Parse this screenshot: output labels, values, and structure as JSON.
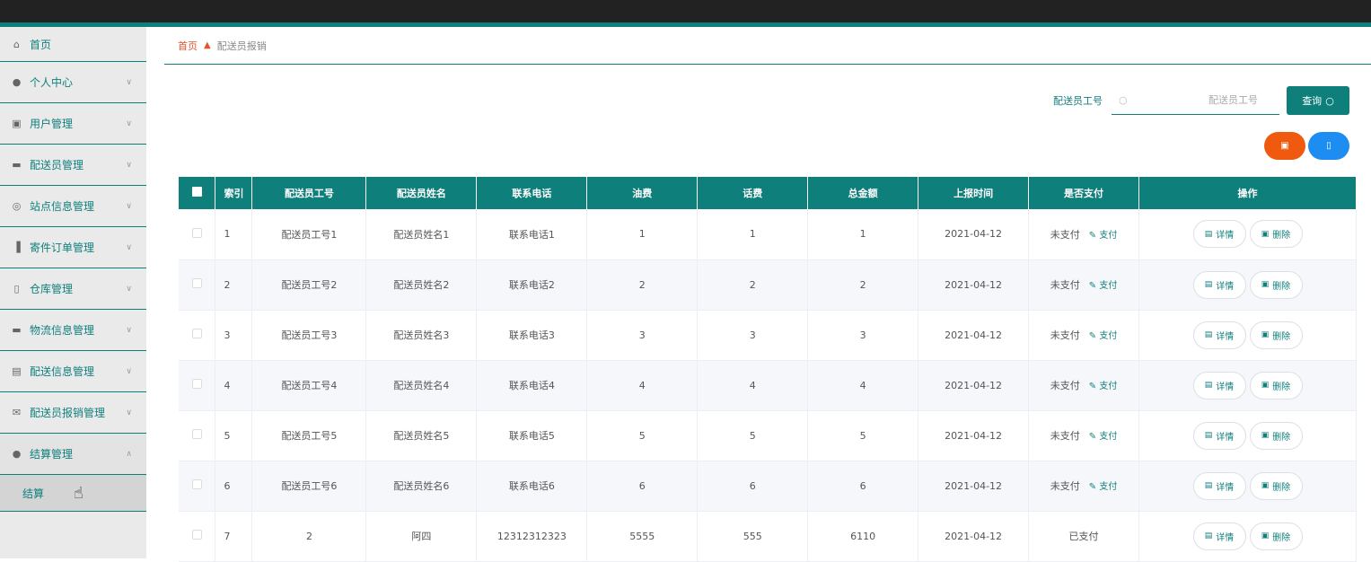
{
  "sidebar": {
    "items": [
      {
        "label": "首页",
        "icon": "home-icon",
        "glyph": "⌂",
        "chevron": ""
      },
      {
        "label": "个人中心",
        "icon": "user-icon",
        "glyph": "●",
        "chevron": "∨"
      },
      {
        "label": "用户管理",
        "icon": "clipboard-icon",
        "glyph": "▣",
        "chevron": "∨"
      },
      {
        "label": "配送员管理",
        "icon": "monitor-icon",
        "glyph": "▬",
        "chevron": "∨"
      },
      {
        "label": "站点信息管理",
        "icon": "compass-icon",
        "glyph": "◎",
        "chevron": "∨"
      },
      {
        "label": "寄件订单管理",
        "icon": "bar-chart-icon",
        "glyph": "▐",
        "chevron": "∨"
      },
      {
        "label": "仓库管理",
        "icon": "box-icon",
        "glyph": "▯",
        "chevron": "∨"
      },
      {
        "label": "物流信息管理",
        "icon": "monitor-icon",
        "glyph": "▬",
        "chevron": "∨"
      },
      {
        "label": "配送信息管理",
        "icon": "briefcase-icon",
        "glyph": "▤",
        "chevron": "∨"
      },
      {
        "label": "配送员报销管理",
        "icon": "mail-icon",
        "glyph": "✉",
        "chevron": "∨"
      },
      {
        "label": "结算管理",
        "icon": "user-icon",
        "glyph": "●",
        "chevron": "∧"
      }
    ],
    "sub_item": "结算"
  },
  "breadcrumb": {
    "home": "首页",
    "current": "配送员报销"
  },
  "search": {
    "label": "配送员工号",
    "placeholder": "配送员工号",
    "button": "查询"
  },
  "table": {
    "headers": [
      "索引",
      "配送员工号",
      "配送员姓名",
      "联系电话",
      "油费",
      "话费",
      "总金额",
      "上报时间",
      "是否支付",
      "操作"
    ],
    "rows": [
      {
        "idx": "1",
        "no": "配送员工号1",
        "name": "配送员姓名1",
        "phone": "联系电话1",
        "oil": "1",
        "tel": "1",
        "total": "1",
        "date": "2021-04-12",
        "status": "未支付",
        "pay": "支付"
      },
      {
        "idx": "2",
        "no": "配送员工号2",
        "name": "配送员姓名2",
        "phone": "联系电话2",
        "oil": "2",
        "tel": "2",
        "total": "2",
        "date": "2021-04-12",
        "status": "未支付",
        "pay": "支付"
      },
      {
        "idx": "3",
        "no": "配送员工号3",
        "name": "配送员姓名3",
        "phone": "联系电话3",
        "oil": "3",
        "tel": "3",
        "total": "3",
        "date": "2021-04-12",
        "status": "未支付",
        "pay": "支付"
      },
      {
        "idx": "4",
        "no": "配送员工号4",
        "name": "配送员姓名4",
        "phone": "联系电话4",
        "oil": "4",
        "tel": "4",
        "total": "4",
        "date": "2021-04-12",
        "status": "未支付",
        "pay": "支付"
      },
      {
        "idx": "5",
        "no": "配送员工号5",
        "name": "配送员姓名5",
        "phone": "联系电话5",
        "oil": "5",
        "tel": "5",
        "total": "5",
        "date": "2021-04-12",
        "status": "未支付",
        "pay": "支付"
      },
      {
        "idx": "6",
        "no": "配送员工号6",
        "name": "配送员姓名6",
        "phone": "联系电话6",
        "oil": "6",
        "tel": "6",
        "total": "6",
        "date": "2021-04-12",
        "status": "未支付",
        "pay": "支付"
      },
      {
        "idx": "7",
        "no": "2",
        "name": "阿四",
        "phone": "12312312323",
        "oil": "5555",
        "tel": "555",
        "total": "6110",
        "date": "2021-04-12",
        "status": "已支付",
        "pay": ""
      }
    ],
    "detail_label": "详情",
    "delete_label": "删除"
  },
  "colors": {
    "accent": "#0f7f7c",
    "danger": "#f05a0f",
    "info": "#1d8df2",
    "breadcrumb_home": "#e2542d"
  }
}
